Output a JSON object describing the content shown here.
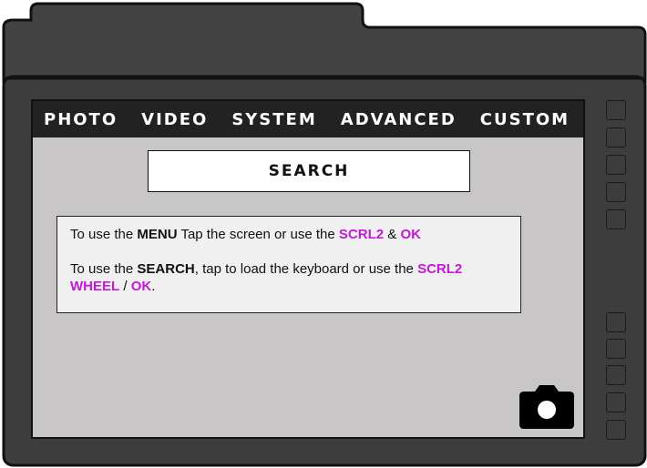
{
  "menu": {
    "tabs": [
      {
        "label": "PHOTO"
      },
      {
        "label": "VIDEO"
      },
      {
        "label": "SYSTEM"
      },
      {
        "label": "ADVANCED"
      },
      {
        "label": "CUSTOM"
      }
    ]
  },
  "search": {
    "label": "SEARCH"
  },
  "info": {
    "line1": {
      "prefix": "To use the ",
      "menu_word": "MENU",
      "middle": " Tap the screen or use the ",
      "scrl2": "SCRL2",
      "amp": " & ",
      "ok": "OK"
    },
    "line2": {
      "prefix": "To use the ",
      "search_word": "SEARCH",
      "middle": ", tap to load the keyboard or use the ",
      "scrl2": "SCRL2",
      "wheel": "WHEEL",
      "slash": " / ",
      "ok": "OK",
      "end": "."
    }
  },
  "icons": {
    "camera": "camera-icon"
  },
  "colors": {
    "body": "#3d3d3d",
    "screen": "#c8c6c6",
    "menu_bar": "#222222",
    "highlight": "#c21ad6",
    "info_bg": "#f0f0f0"
  }
}
